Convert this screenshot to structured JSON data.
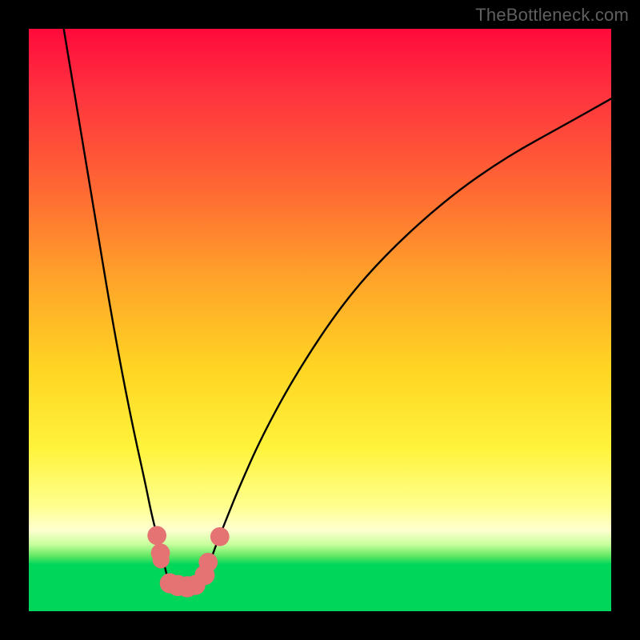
{
  "watermark": "TheBottleneck.com",
  "chart_data": {
    "type": "line",
    "title": "",
    "xlabel": "",
    "ylabel": "",
    "xlim": [
      0,
      100
    ],
    "ylim": [
      0,
      100
    ],
    "series": [
      {
        "name": "left-branch",
        "x": [
          6,
          8,
          10,
          12,
          14,
          16,
          18,
          20,
          21,
          22,
          22.8,
          23.5,
          24
        ],
        "y": [
          100,
          88,
          76,
          64,
          52,
          41,
          31,
          22,
          17,
          13,
          10,
          7,
          5
        ]
      },
      {
        "name": "right-branch",
        "x": [
          30,
          31,
          32,
          34,
          36,
          40,
          46,
          54,
          62,
          72,
          82,
          92,
          100
        ],
        "y": [
          5,
          8,
          11,
          16,
          21,
          30,
          41,
          53,
          62,
          71,
          78,
          83.5,
          88
        ]
      }
    ],
    "markers": {
      "name": "highlight-dots",
      "color": "#e57373",
      "points": [
        {
          "x": 22.0,
          "y": 13.0,
          "r": 1.2
        },
        {
          "x": 22.6,
          "y": 10.0,
          "r": 1.2
        },
        {
          "x": 22.7,
          "y": 8.8,
          "r": 1.0
        },
        {
          "x": 24.2,
          "y": 4.8,
          "r": 1.3
        },
        {
          "x": 25.6,
          "y": 4.4,
          "r": 1.4
        },
        {
          "x": 27.2,
          "y": 4.2,
          "r": 1.4
        },
        {
          "x": 28.6,
          "y": 4.5,
          "r": 1.3
        },
        {
          "x": 30.2,
          "y": 6.2,
          "r": 1.3
        },
        {
          "x": 30.8,
          "y": 8.4,
          "r": 1.2
        },
        {
          "x": 32.8,
          "y": 12.8,
          "r": 1.2
        }
      ]
    },
    "background_gradient": {
      "top": "#ff0a3b",
      "mid1": "#ffa02a",
      "mid2": "#fff33a",
      "bottom": "#00d65a"
    }
  }
}
